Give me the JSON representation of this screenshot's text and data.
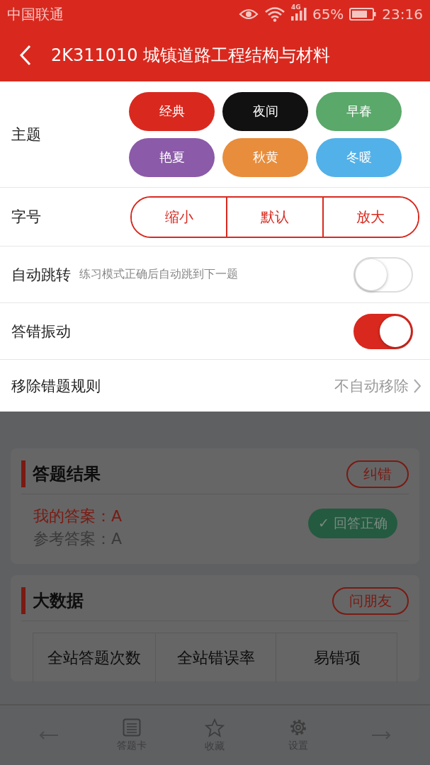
{
  "status_bar": {
    "carrier": "中国联通",
    "network": "4G",
    "battery": "65%",
    "time": "23:16"
  },
  "header": {
    "title": "2K311010 城镇道路工程结构与材料"
  },
  "settings": {
    "theme": {
      "label": "主题",
      "options": [
        {
          "label": "经典",
          "color": "#d9291f"
        },
        {
          "label": "夜间",
          "color": "#111111"
        },
        {
          "label": "早春",
          "color": "#5aa86a"
        },
        {
          "label": "艳夏",
          "color": "#8b5aa8"
        },
        {
          "label": "秋黄",
          "color": "#e88d3c"
        },
        {
          "label": "冬暖",
          "color": "#52b1e8"
        }
      ]
    },
    "font_size": {
      "label": "字号",
      "options": [
        "缩小",
        "默认",
        "放大"
      ]
    },
    "toggles": [
      {
        "label": "自动跳转",
        "hint": "练习模式正确后自动跳到下一题",
        "on": false
      },
      {
        "label": "答错振动",
        "on": true
      }
    ],
    "remove_rule": {
      "label": "移除错题规则",
      "value": "不自动移除"
    }
  },
  "result_card": {
    "title": "答题结果",
    "button": "纠错",
    "my_answer": "我的答案：A",
    "reference_answer": "参考答案：A",
    "badge": "✓ 回答正确"
  },
  "big_data": {
    "title": "大数据",
    "button": "问朋友",
    "columns": [
      "全站答题次数",
      "全站错误率",
      "易错项"
    ]
  },
  "bottom_nav": [
    {
      "kind": "prev"
    },
    {
      "kind": "card",
      "label": "答题卡"
    },
    {
      "kind": "star",
      "label": "收藏"
    },
    {
      "kind": "gear",
      "label": "设置"
    },
    {
      "kind": "next"
    }
  ]
}
